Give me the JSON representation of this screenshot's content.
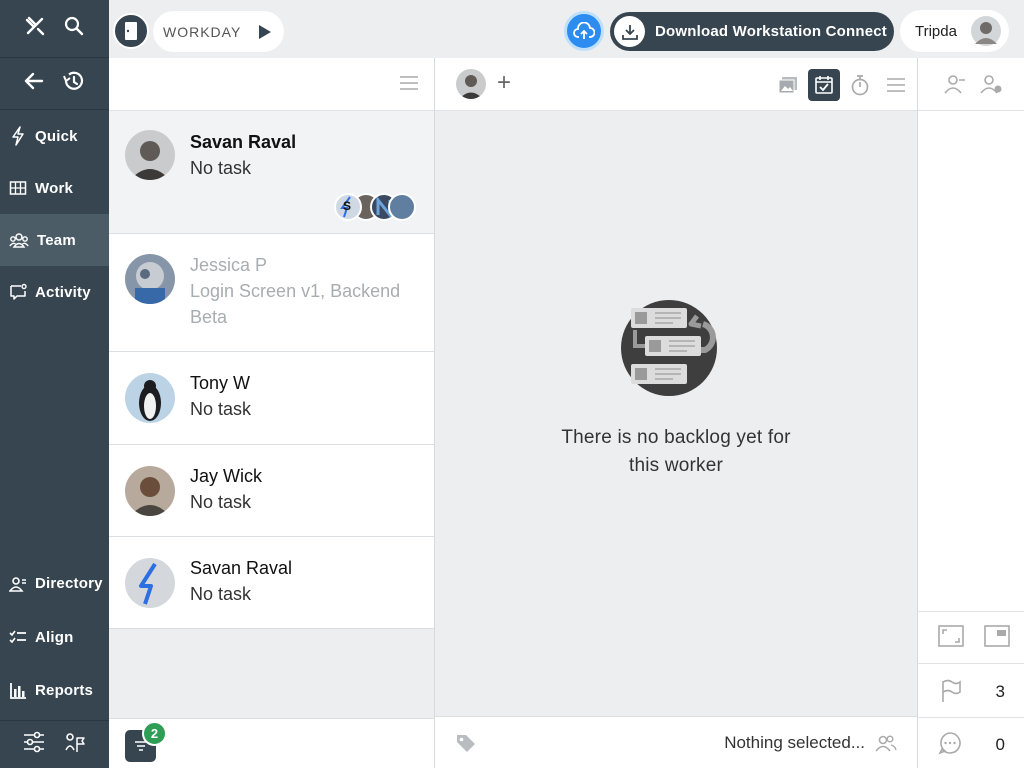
{
  "nav": {
    "items": [
      {
        "label": "Quick",
        "icon": "lightning-icon"
      },
      {
        "label": "Work",
        "icon": "board-icon"
      },
      {
        "label": "Team",
        "icon": "team-icon",
        "active": true
      },
      {
        "label": "Activity",
        "icon": "chat-icon"
      }
    ],
    "bottom_items": [
      {
        "label": "Directory",
        "icon": "directory-icon"
      },
      {
        "label": "Align",
        "icon": "checklist-icon"
      },
      {
        "label": "Reports",
        "icon": "bar-chart-icon"
      }
    ]
  },
  "topbar": {
    "workday_label": "WORKDAY",
    "download_label": "Download Workstation Connect",
    "user_name": "Tripda"
  },
  "workers": [
    {
      "name": "Savan Raval",
      "task": "No task",
      "selected": true
    },
    {
      "name": "Jessica P",
      "task": "Login Screen v1, Backend Beta",
      "dim": true
    },
    {
      "name": "Tony W",
      "task": "No task"
    },
    {
      "name": "Jay Wick",
      "task": "No task"
    },
    {
      "name": "Savan Raval",
      "task": "No task"
    }
  ],
  "list": {
    "filter_count": "2",
    "mini_avatar_letter": "S"
  },
  "main": {
    "empty_text": "There is no backlog yet for this worker",
    "footer_text": "Nothing selected..."
  },
  "right": {
    "flag_count": "3",
    "comment_count": "0"
  },
  "colors": {
    "nav_bg": "#374550",
    "accent_blue": "#2d8cf0",
    "badge_green": "#2e9e57"
  }
}
